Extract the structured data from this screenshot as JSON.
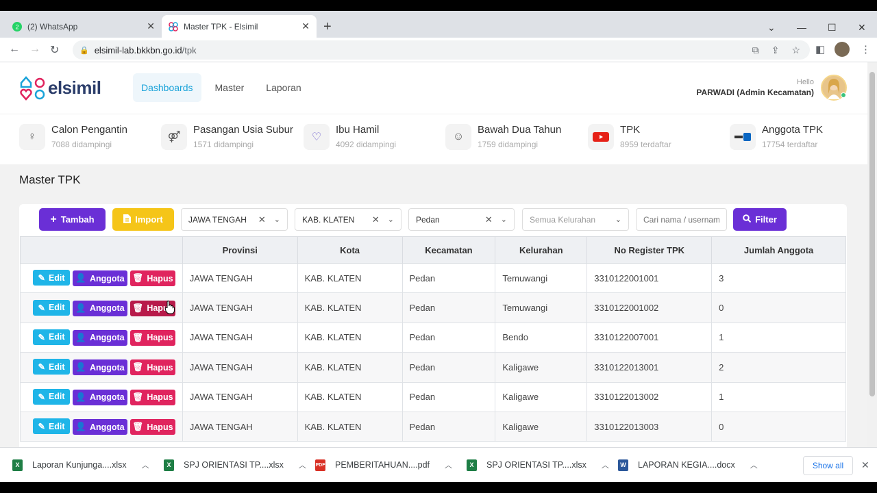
{
  "browser": {
    "tabs": [
      {
        "title": "(2) WhatsApp",
        "favicon": "whatsapp-icon",
        "active": false
      },
      {
        "title": "Master TPK - Elsimil",
        "favicon": "elsimil-icon",
        "active": true
      }
    ],
    "url_host": "elsimil-lab.bkkbn.go.id",
    "url_path": "/tpk"
  },
  "app": {
    "logo_text": "elsimil",
    "nav": [
      "Dashboards",
      "Master",
      "Laporan"
    ],
    "active_nav": "Dashboards",
    "user": {
      "greeting": "Hello",
      "name": "PARWADI (Admin Kecamatan)"
    }
  },
  "stats": [
    {
      "title": "Calon Pengantin",
      "sub": "7088 didampingi",
      "icon": "bride-icon"
    },
    {
      "title": "Pasangan Usia Subur",
      "sub": "1571 didampingi",
      "icon": "couple-icon"
    },
    {
      "title": "Ibu Hamil",
      "sub": "4092 didampingi",
      "icon": "pregnant-icon"
    },
    {
      "title": "Bawah Dua Tahun",
      "sub": "1759 didampingi",
      "icon": "baby-icon"
    },
    {
      "title": "TPK",
      "sub": "8959 terdaftar",
      "icon": "youtube-icon"
    },
    {
      "title": "Anggota TPK",
      "sub": "17754 terdaftar",
      "icon": "linkedin-icon"
    }
  ],
  "page_title": "Master TPK",
  "toolbar": {
    "tambah_label": "Tambah",
    "import_label": "Import",
    "provinsi": "JAWA TENGAH",
    "kota": "KAB. KLATEN",
    "kecamatan": "Pedan",
    "kelurahan_placeholder": "Semua Kelurahan",
    "search_placeholder": "Cari nama / username",
    "filter_label": "Filter"
  },
  "table": {
    "headers": [
      "",
      "Provinsi",
      "Kota",
      "Kecamatan",
      "Kelurahan",
      "No Register TPK",
      "Jumlah Anggota"
    ],
    "action_labels": {
      "edit": "Edit",
      "anggota": "Anggota",
      "hapus": "Hapus"
    },
    "rows": [
      {
        "provinsi": "JAWA TENGAH",
        "kota": "KAB. KLATEN",
        "kecamatan": "Pedan",
        "kelurahan": "Temuwangi",
        "no_register": "3310122001001",
        "jumlah": "3"
      },
      {
        "provinsi": "JAWA TENGAH",
        "kota": "KAB. KLATEN",
        "kecamatan": "Pedan",
        "kelurahan": "Temuwangi",
        "no_register": "3310122001002",
        "jumlah": "0"
      },
      {
        "provinsi": "JAWA TENGAH",
        "kota": "KAB. KLATEN",
        "kecamatan": "Pedan",
        "kelurahan": "Bendo",
        "no_register": "3310122007001",
        "jumlah": "1"
      },
      {
        "provinsi": "JAWA TENGAH",
        "kota": "KAB. KLATEN",
        "kecamatan": "Pedan",
        "kelurahan": "Kaligawe",
        "no_register": "3310122013001",
        "jumlah": "2"
      },
      {
        "provinsi": "JAWA TENGAH",
        "kota": "KAB. KLATEN",
        "kecamatan": "Pedan",
        "kelurahan": "Kaligawe",
        "no_register": "3310122013002",
        "jumlah": "1"
      },
      {
        "provinsi": "JAWA TENGAH",
        "kota": "KAB. KLATEN",
        "kecamatan": "Pedan",
        "kelurahan": "Kaligawe",
        "no_register": "3310122013003",
        "jumlah": "0"
      }
    ]
  },
  "downloads": [
    {
      "name": "Laporan Kunjunga....xlsx",
      "type": "xlsx"
    },
    {
      "name": "SPJ ORIENTASI TP....xlsx",
      "type": "xlsx"
    },
    {
      "name": "PEMBERITAHUAN....pdf",
      "type": "pdf"
    },
    {
      "name": "SPJ ORIENTASI TP....xlsx",
      "type": "xlsx"
    },
    {
      "name": "LAPORAN KEGIA....docx",
      "type": "docx"
    }
  ],
  "downloads_show_all": "Show all",
  "colors": {
    "primary": "#6a2fd6",
    "accent": "#1aa3d9",
    "warning": "#f5c518",
    "danger": "#e0245e",
    "info": "#1fb5e8"
  }
}
